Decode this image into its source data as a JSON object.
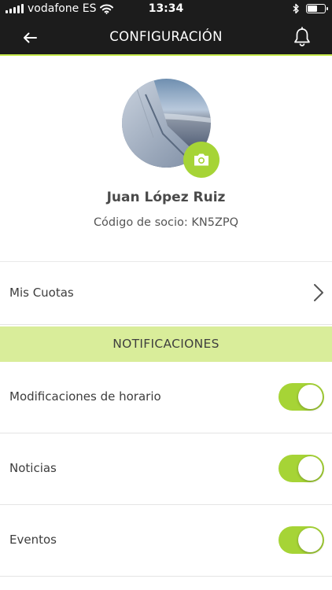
{
  "status_bar": {
    "carrier": "vodafone ES",
    "time": "13:34",
    "battery_level": 0.55
  },
  "nav": {
    "title": "CONFIGURACIÓN",
    "back_icon": "arrow-left-icon",
    "bell_icon": "bell-icon"
  },
  "profile": {
    "name": "Juan López Ruiz",
    "code": "Código de socio: KN5ZPQ",
    "camera_icon": "camera-icon"
  },
  "menu": {
    "cuotas_label": "Mis Cuotas"
  },
  "notifications": {
    "header": "NOTIFICACIONES",
    "items": [
      {
        "label": "Modificaciones de horario",
        "enabled": true
      },
      {
        "label": "Noticias",
        "enabled": true
      },
      {
        "label": "Eventos",
        "enabled": true
      }
    ]
  },
  "colors": {
    "nav_bg": "#1c1c1c",
    "accent": "#a6d436",
    "section_bg": "#d9ed9a"
  }
}
